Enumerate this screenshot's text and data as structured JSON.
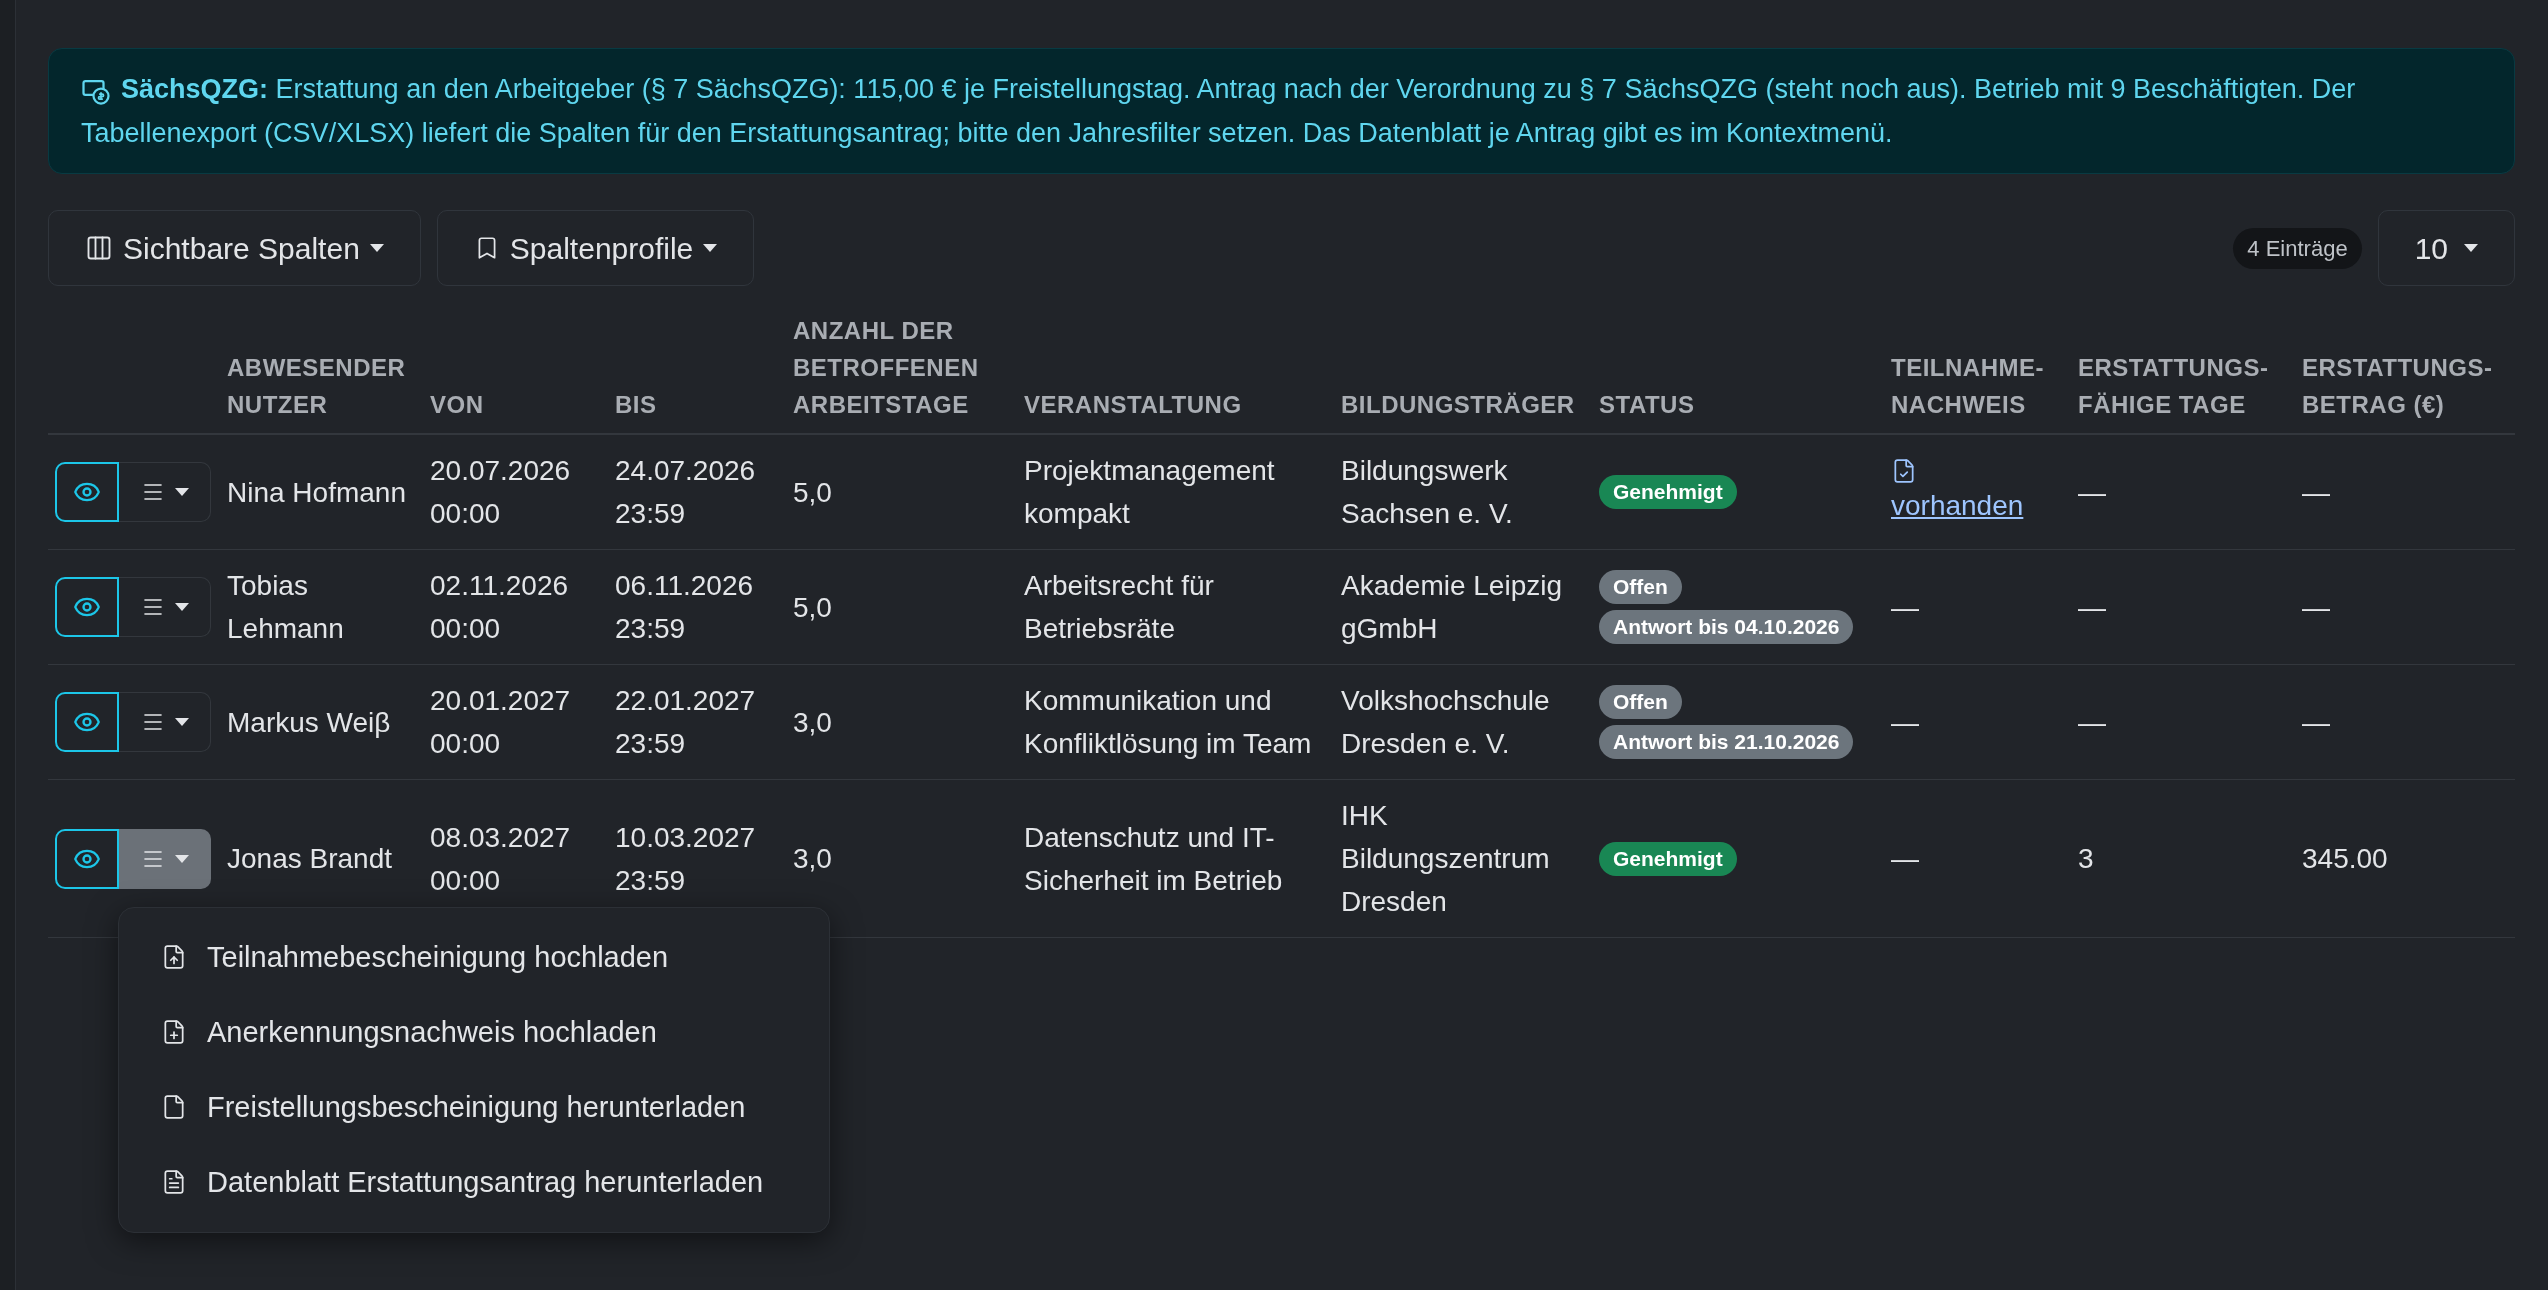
{
  "alert": {
    "title": "SächsQZG:",
    "text": "Erstattung an den Arbeitgeber (§ 7 SächsQZG): 115,00 € je Freistellungstag. Antrag nach der Verordnung zu § 7 SächsQZG (steht noch aus). Betrieb mit 9 Beschäftigten. Der Tabellenexport (CSV/XLSX) liefert die Spalten für den Erstattungsantrag; bitte den Jahresfilter setzen. Das Datenblatt je Antrag gibt es im Kontextmenü."
  },
  "toolbar": {
    "buttons": [
      {
        "label": "Sichtbare Spalten",
        "kind": "columns"
      },
      {
        "label": "Spaltenprofile",
        "kind": "bookmark"
      }
    ],
    "count": "4 Einträge",
    "page_size": "10"
  },
  "table": {
    "columns": [
      "ABWESENDER NUTZER",
      "VON",
      "BIS",
      "ANZAHL DER BETROFFENEN ARBEITSTAGE",
      "VERANSTALTUNG",
      "BILDUNGSTRÄGER",
      "STATUS",
      "TEILNAHME- NACHWEIS",
      "ERSTATTUNGS- FÄHIGE TAGE",
      "ERSTATTUNGS- BETRAG (€)"
    ],
    "rows": [
      {
        "menu_open": false,
        "user": "Nina Hofmann",
        "von": "20.07.2026 00:00",
        "bis": "24.07.2026 23:59",
        "days": "5,0",
        "event": "Projektmanagement kompakt",
        "provider": "Bildungswerk Sachsen e. V.",
        "status": [
          {
            "text": "Genehmigt",
            "kind": "success"
          }
        ],
        "proof": {
          "kind": "link",
          "text": "vorhanden"
        },
        "refund_days": "—",
        "amount": "—"
      },
      {
        "menu_open": false,
        "user": "Tobias Lehmann",
        "von": "02.11.2026 00:00",
        "bis": "06.11.2026 23:59",
        "days": "5,0",
        "event": "Arbeitsrecht für Betriebsräte",
        "provider": "Akademie Leipzig gGmbH",
        "status": [
          {
            "text": "Offen",
            "kind": "neutral"
          },
          {
            "text": "Antwort bis 04.10.2026",
            "kind": "neutral"
          }
        ],
        "proof": {
          "kind": "text",
          "text": "—"
        },
        "refund_days": "—",
        "amount": "—"
      },
      {
        "menu_open": false,
        "user": "Markus Weiβ",
        "von": "20.01.2027 00:00",
        "bis": "22.01.2027 23:59",
        "days": "3,0",
        "event": "Kommunikation und Konfliktlösung im Team",
        "provider": "Volkshochschule Dresden e. V.",
        "status": [
          {
            "text": "Offen",
            "kind": "neutral"
          },
          {
            "text": "Antwort bis 21.10.2026",
            "kind": "neutral"
          }
        ],
        "proof": {
          "kind": "text",
          "text": "—"
        },
        "refund_days": "—",
        "amount": "—"
      },
      {
        "menu_open": true,
        "user": "Jonas Brandt",
        "von": "08.03.2027 00:00",
        "bis": "10.03.2027 23:59",
        "days": "3,0",
        "event": "Datenschutz und IT-Sicherheit im Betrieb",
        "provider": "IHK Bildungszentrum Dresden",
        "status": [
          {
            "text": "Genehmigt",
            "kind": "success"
          }
        ],
        "proof": {
          "kind": "text",
          "text": "—"
        },
        "refund_days": "3",
        "amount": "345.00"
      }
    ]
  },
  "context_menu": {
    "items": [
      {
        "label": "Teilnahmebescheinigung hochladen",
        "kind": "upload"
      },
      {
        "label": "Anerkennungsnachweis hochladen",
        "kind": "add"
      },
      {
        "label": "Freistellungsbescheinigung herunterladen",
        "kind": "pdf"
      },
      {
        "label": "Datenblatt Erstattungsantrag herunterladen",
        "kind": "doc"
      }
    ]
  }
}
